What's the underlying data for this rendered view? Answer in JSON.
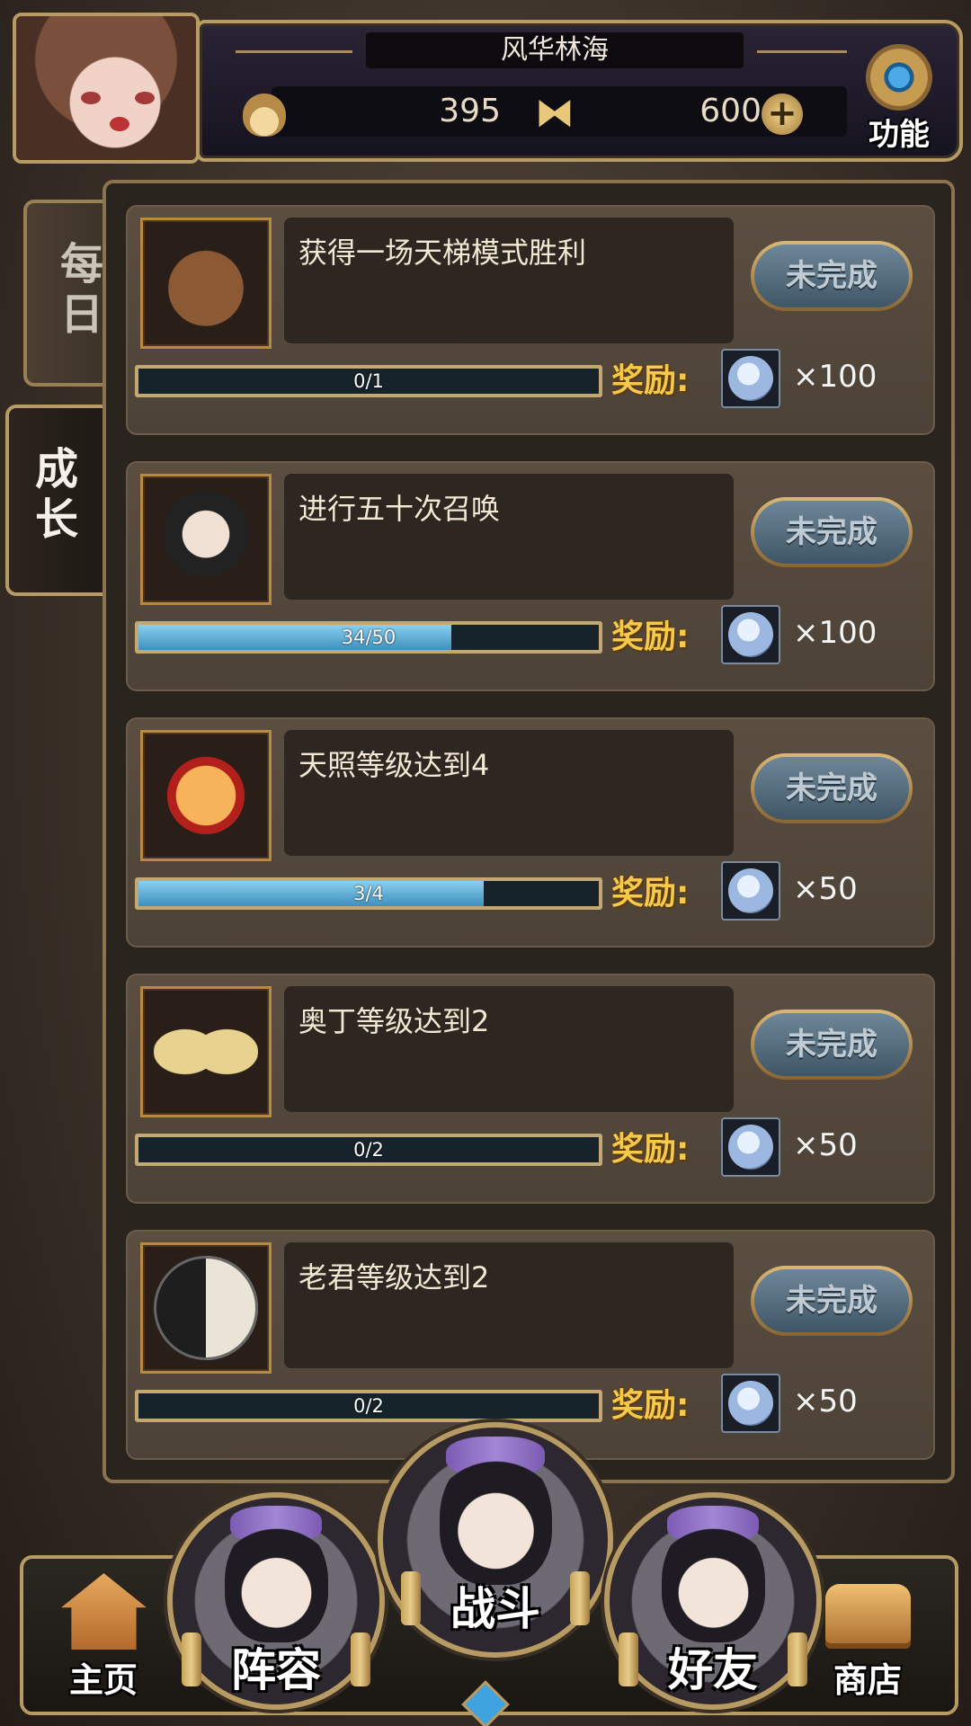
{
  "header": {
    "region_name": "风华林海",
    "resource_1_value": "395",
    "resource_2_value": "600",
    "function_label": "功能"
  },
  "tabs": [
    {
      "label": "每日",
      "active": false
    },
    {
      "label": "成长",
      "active": true
    }
  ],
  "reward_label": "奖励:",
  "tasks": [
    {
      "icon": "bears-icon",
      "description": "获得一场天梯模式胜利",
      "status": "未完成",
      "progress_text": "0/1",
      "progress": 0.0,
      "reward_qty": "×100"
    },
    {
      "icon": "summon-girl-icon",
      "description": "进行五十次召唤",
      "status": "未完成",
      "progress_text": "34/50",
      "progress": 0.68,
      "reward_qty": "×100"
    },
    {
      "icon": "sun-spirit-icon",
      "description": "天照等级达到4",
      "status": "未完成",
      "progress_text": "3/4",
      "progress": 0.75,
      "reward_qty": "×50"
    },
    {
      "icon": "wings-icon",
      "description": "奥丁等级达到2",
      "status": "未完成",
      "progress_text": "0/2",
      "progress": 0.0,
      "reward_qty": "×50"
    },
    {
      "icon": "yinyang-icon",
      "description": "老君等级达到2",
      "status": "未完成",
      "progress_text": "0/2",
      "progress": 0.0,
      "reward_qty": "×50"
    }
  ],
  "nav": {
    "home": "主页",
    "team": "阵容",
    "battle": "战斗",
    "friends": "好友",
    "shop": "商店"
  },
  "colors": {
    "reward_gold": "#f6c94a",
    "progress_blue": "#3e8fbf",
    "frame_gold": "#b89a63"
  }
}
